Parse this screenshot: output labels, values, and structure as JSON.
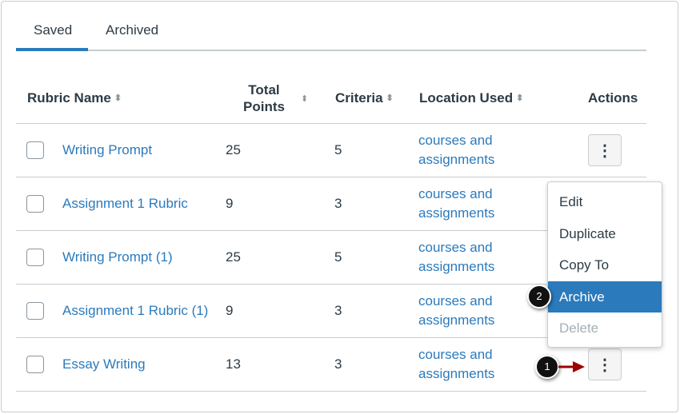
{
  "tabs": [
    {
      "label": "Saved",
      "active": true
    },
    {
      "label": "Archived",
      "active": false
    }
  ],
  "columns": {
    "name": "Rubric Name",
    "points_1": "Total",
    "points_2": "Points",
    "criteria": "Criteria",
    "location": "Location Used",
    "actions": "Actions"
  },
  "rows": [
    {
      "name": "Writing Prompt",
      "points": "25",
      "criteria": "5",
      "loc1": "courses and",
      "loc2": "assignments"
    },
    {
      "name": "Assignment 1 Rubric",
      "points": "9",
      "criteria": "3",
      "loc1": "courses and",
      "loc2": "assignments"
    },
    {
      "name": "Writing Prompt (1)",
      "points": "25",
      "criteria": "5",
      "loc1": "courses and",
      "loc2": "assignments"
    },
    {
      "name": "Assignment 1 Rubric (1)",
      "points": "9",
      "criteria": "3",
      "loc1": "courses and",
      "loc2": "assignments"
    },
    {
      "name": "Essay Writing",
      "points": "13",
      "criteria": "3",
      "loc1": "courses and",
      "loc2": "assignments"
    }
  ],
  "menu": [
    "Edit",
    "Duplicate",
    "Copy To",
    "Archive",
    "Delete"
  ],
  "callouts": [
    "1",
    "2"
  ],
  "sort_glyph": "⬍",
  "kebab_glyph": "⋮",
  "colors": {
    "accent": "#2b7abc",
    "arrow": "#a00000"
  }
}
